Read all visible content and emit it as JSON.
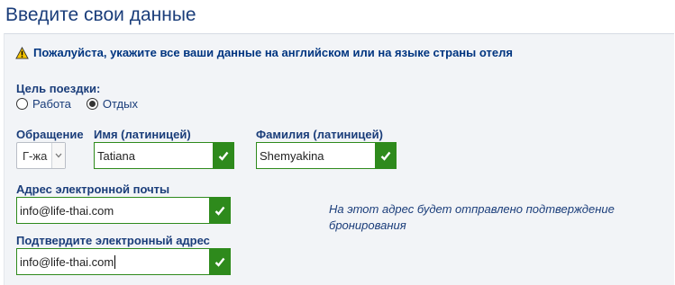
{
  "header": {
    "title": "Введите свои данные"
  },
  "notice": {
    "text": "Пожалуйста, укажите все ваши данные на английском или на языке страны отеля"
  },
  "trip_purpose": {
    "label": "Цель поездки:",
    "options": [
      {
        "label": "Работа",
        "selected": false
      },
      {
        "label": "Отдых",
        "selected": true
      }
    ]
  },
  "salutation": {
    "label": "Обращение",
    "value": "Г-жа"
  },
  "first_name": {
    "label": "Имя (латиницей)",
    "value": "Tatiana"
  },
  "last_name": {
    "label": "Фамилия (латиницей)",
    "value": "Shemyakina"
  },
  "email": {
    "label": "Адрес электронной почты",
    "value": "info@life-thai.com"
  },
  "confirm_email": {
    "label": "Подтвердите электронный адрес",
    "value": "info@life-thai.com"
  },
  "email_hint": "На этот адрес будет отправлено подтверждение бронирования",
  "colors": {
    "valid": "#2e8a1c",
    "text": "#1a3d7a",
    "panel": "#f2f4f7"
  },
  "icons": {
    "notice": "warning-icon",
    "valid": "checkmark-icon"
  }
}
